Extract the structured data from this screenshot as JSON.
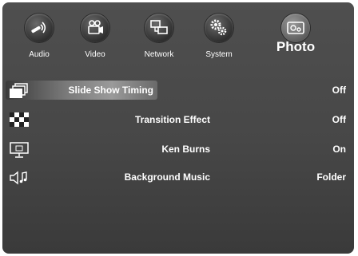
{
  "tabs": [
    {
      "label": "Audio",
      "icon": "audio-icon",
      "active": false
    },
    {
      "label": "Video",
      "icon": "video-camera-icon",
      "active": false
    },
    {
      "label": "Network",
      "icon": "network-icon",
      "active": false
    },
    {
      "label": "System",
      "icon": "gears-icon",
      "active": false
    },
    {
      "label": "Photo",
      "icon": "photo-icon",
      "active": true
    }
  ],
  "settings": [
    {
      "label": "Slide Show Timing",
      "value": "Off",
      "icon": "slides-icon",
      "selected": true
    },
    {
      "label": "Transition Effect",
      "value": "Off",
      "icon": "checkerboard-icon",
      "selected": false
    },
    {
      "label": "Ken Burns",
      "value": "On",
      "icon": "monitor-icon",
      "selected": false
    },
    {
      "label": "Background Music",
      "value": "Folder",
      "icon": "speaker-music-icon",
      "selected": false
    }
  ],
  "colors": {
    "panel": "#484848",
    "text": "#ffffff",
    "highlight": "#8a8a8a"
  }
}
